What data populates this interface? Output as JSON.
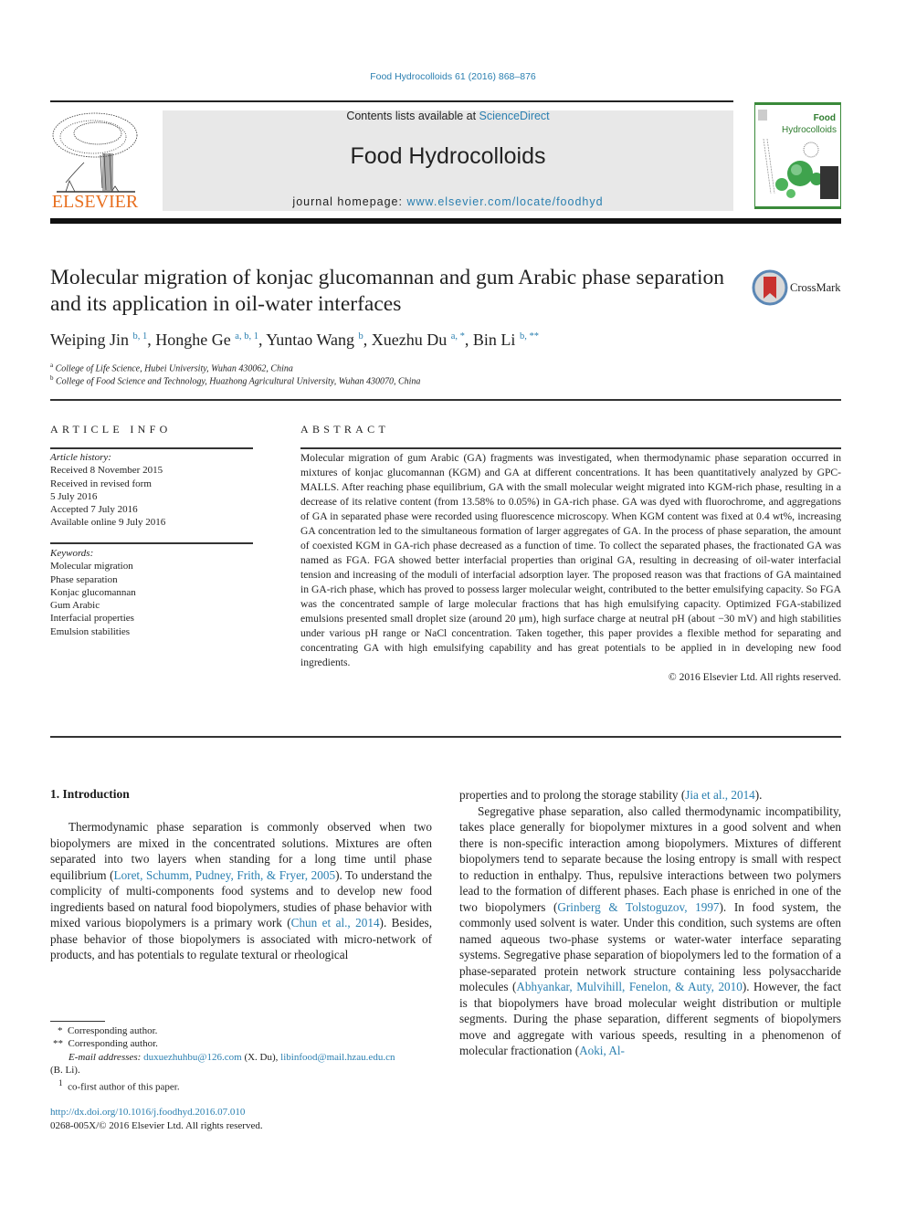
{
  "header": {
    "citation": "Food Hydrocolloids 61 (2016) 868–876",
    "contents_prefix": "Contents lists available at ",
    "contents_link": "ScienceDirect",
    "journal_title": "Food Hydrocolloids",
    "homepage_prefix": "journal homepage: ",
    "homepage_link": "www.elsevier.com/locate/foodhyd",
    "publisher_logo_text": "ELSEVIER",
    "cover_title_line1": "Food",
    "cover_title_line2": "Hydrocolloids",
    "crossmark_label": "CrossMark"
  },
  "article": {
    "title": "Molecular migration of konjac glucomannan and gum Arabic phase separation and its application in oil-water interfaces",
    "authors": [
      {
        "name": "Weiping Jin",
        "sup": "b, 1"
      },
      {
        "name": "Honghe Ge",
        "sup": "a, b, 1"
      },
      {
        "name": "Yuntao Wang",
        "sup": "b"
      },
      {
        "name": "Xuezhu Du",
        "sup": "a, *"
      },
      {
        "name": "Bin Li",
        "sup": "b, **"
      }
    ],
    "affiliations": [
      {
        "key": "a",
        "text": "College of Life Science, Hubei University, Wuhan 430062, China"
      },
      {
        "key": "b",
        "text": "College of Food Science and Technology, Huazhong Agricultural University, Wuhan 430070, China"
      }
    ]
  },
  "article_info": {
    "heading": "ARTICLE INFO",
    "history_label": "Article history:",
    "history": [
      "Received 8 November 2015",
      "Received in revised form",
      "5 July 2016",
      "Accepted 7 July 2016",
      "Available online 9 July 2016"
    ],
    "keywords_label": "Keywords:",
    "keywords": [
      "Molecular migration",
      "Phase separation",
      "Konjac glucomannan",
      "Gum Arabic",
      "Interfacial properties",
      "Emulsion stabilities"
    ]
  },
  "abstract": {
    "heading": "ABSTRACT",
    "text": "Molecular migration of gum Arabic (GA) fragments was investigated, when thermodynamic phase separation occurred in mixtures of konjac glucomannan (KGM) and GA at different concentrations. It has been quantitatively analyzed by GPC-MALLS. After reaching phase equilibrium, GA with the small molecular weight migrated into KGM-rich phase, resulting in a decrease of its relative content (from 13.58% to 0.05%) in GA-rich phase. GA was dyed with fluorochrome, and aggregations of GA in separated phase were recorded using fluorescence microscopy. When KGM content was fixed at 0.4 wt%, increasing GA concentration led to the simultaneous formation of larger aggregates of GA. In the process of phase separation, the amount of coexisted KGM in GA-rich phase decreased as a function of time. To collect the separated phases, the fractionated GA was named as FGA. FGA showed better interfacial properties than original GA, resulting in decreasing of oil-water interfacial tension and increasing of the moduli of interfacial adsorption layer. The proposed reason was that fractions of GA maintained in GA-rich phase, which has proved to possess larger molecular weight, contributed to the better emulsifying capacity. So FGA was the concentrated sample of large molecular fractions that has high emulsifying capacity. Optimized FGA-stabilized emulsions presented small droplet size (around 20 μm), high surface charge at neutral pH (about −30 mV) and high stabilities under various pH range or NaCl concentration. Taken together, this paper provides a flexible method for separating and concentrating GA with high emulsifying capability and has great potentials to be applied in in developing new food ingredients.",
    "copyright": "© 2016 Elsevier Ltd. All rights reserved."
  },
  "introduction": {
    "heading": "1.  Introduction",
    "left_p1_a": "Thermodynamic phase separation is commonly observed when two biopolymers are mixed in the concentrated solutions. Mixtures are often separated into two layers when standing for a long time until phase equilibrium (",
    "left_ref1": "Loret, Schumm, Pudney, Frith, & Fryer, 2005",
    "left_p1_b": "). To understand the complicity of multi-components food systems and to develop new food ingredients based on natural food biopolymers, studies of phase behavior with mixed various biopolymers is a primary work (",
    "left_ref2": "Chun et al., 2014",
    "left_p1_c": "). Besides, phase behavior of those biopolymers is associated with micro-network of products, and has potentials to regulate textural or rheological",
    "right_p1_a": "properties and to prolong the storage stability (",
    "right_ref1": "Jia et al., 2014",
    "right_p1_b": ").",
    "right_p2_a": "Segregative phase separation, also called thermodynamic incompatibility, takes place generally for biopolymer mixtures in a good solvent and when there is non-specific interaction among biopolymers. Mixtures of different biopolymers tend to separate because the losing entropy is small with respect to reduction in enthalpy. Thus, repulsive interactions between two polymers lead to the formation of different phases. Each phase is enriched in one of the two biopolymers (",
    "right_ref2": "Grinberg & Tolstoguzov, 1997",
    "right_p2_b": "). In food system, the commonly used solvent is water. Under this condition, such systems are often named aqueous two-phase systems or water-water interface separating systems. Segregative phase separation of biopolymers led to the formation of a phase-separated protein network structure containing less polysaccharide molecules (",
    "right_ref3": "Abhyankar, Mulvihill, Fenelon, & Auty, 2010",
    "right_p2_c": "). However, the fact is that biopolymers have broad molecular weight distribution or multiple segments. During the phase separation, different segments of biopolymers move and aggregate with various speeds, resulting in a phenomenon of molecular fractionation (",
    "right_ref4": "Aoki, Al-"
  },
  "footnotes": {
    "star1_mark": "*",
    "star1_text": "Corresponding author.",
    "star2_mark": "**",
    "star2_text": "Corresponding author.",
    "email_label": "E-mail addresses:",
    "email1": "duxuezhuhbu@126.com",
    "email1_who": " (X. Du), ",
    "email2": "libinfood@mail.hzau.edu.cn",
    "email2_who": "(B. Li).",
    "note1_mark": "1",
    "note1_text": "co-first author of this paper.",
    "doi": "http://dx.doi.org/10.1016/j.foodhyd.2016.07.010",
    "issn": "0268-005X/© 2016 Elsevier Ltd. All rights reserved."
  }
}
